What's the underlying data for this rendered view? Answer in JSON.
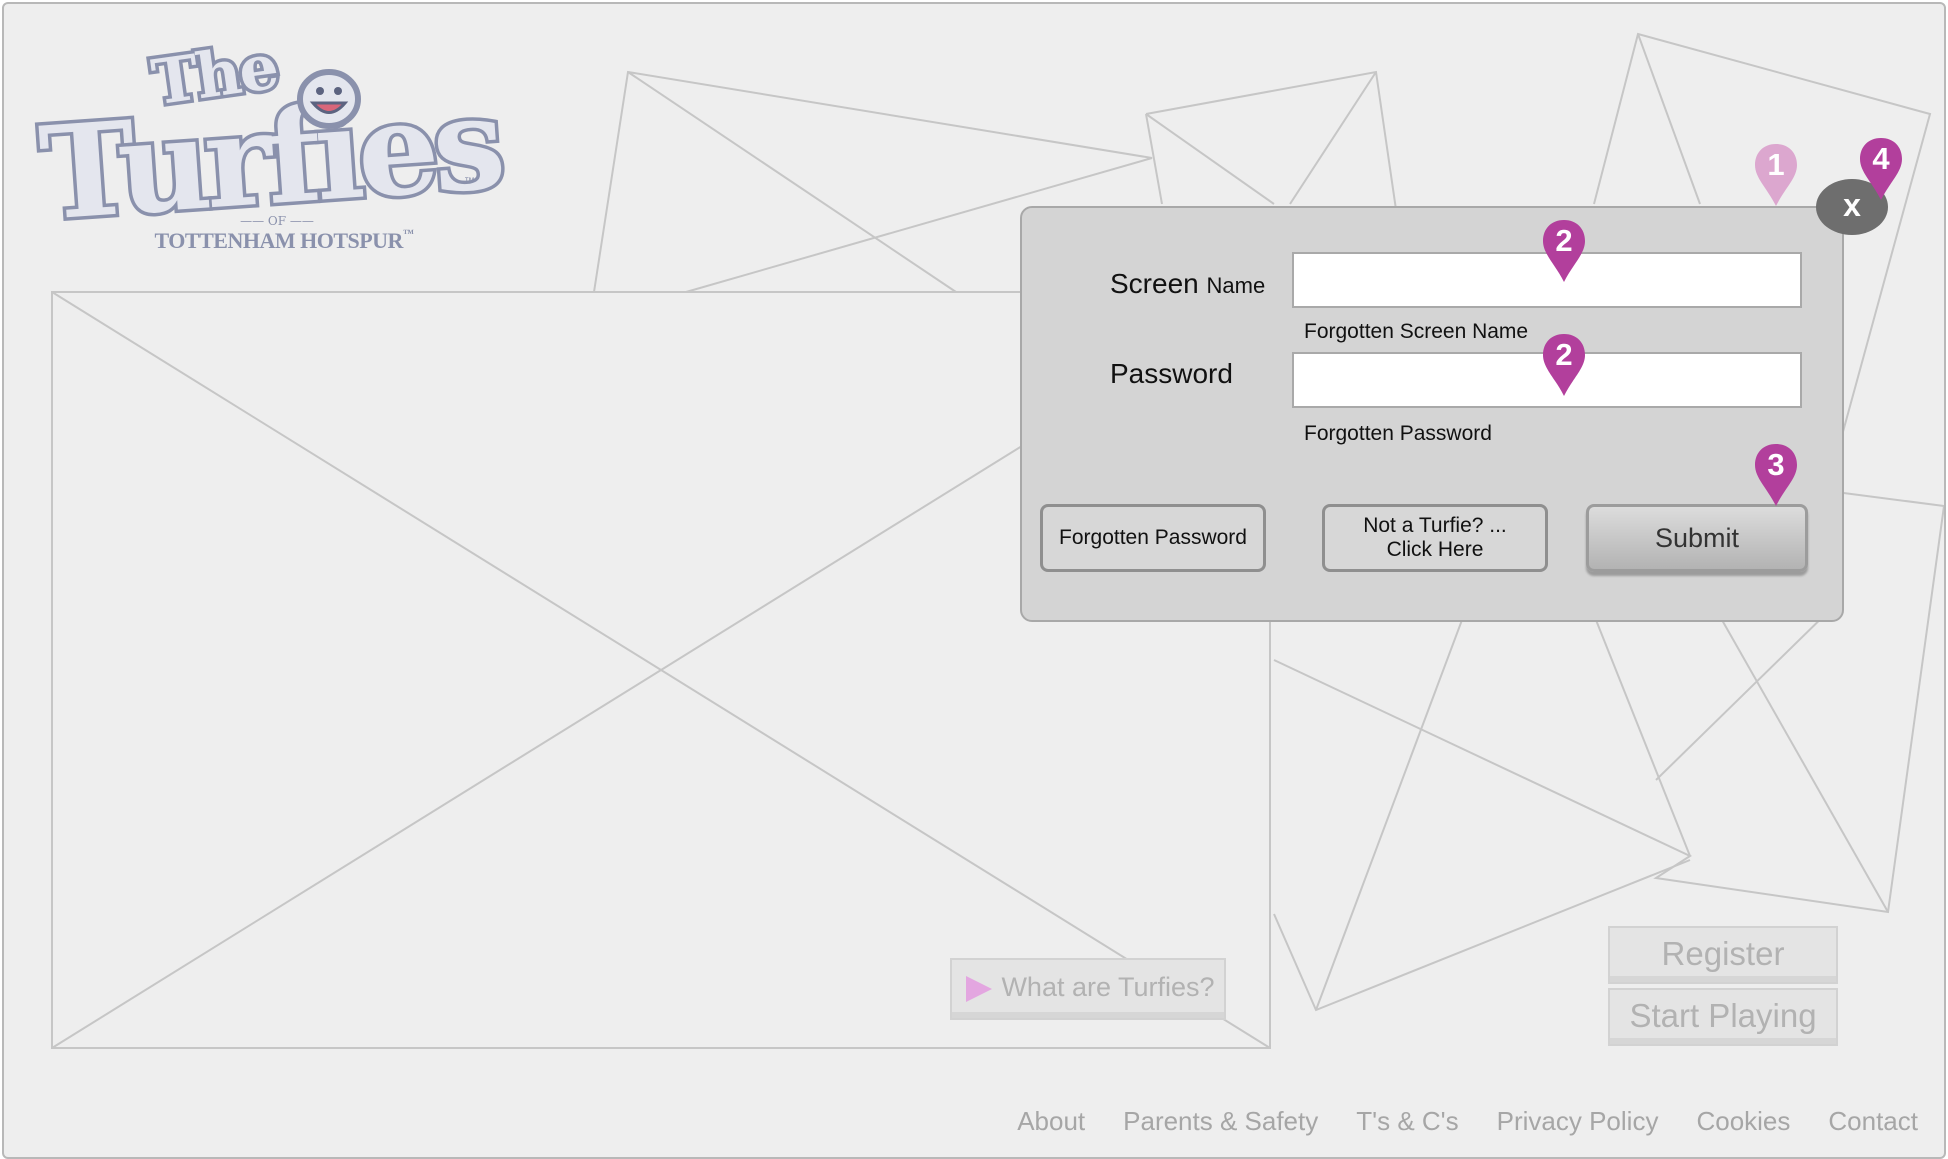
{
  "logo": {
    "title_small": "The",
    "title_large": "Turfies",
    "of": "OF",
    "subtitle": "TOTTENHAM HOTSPUR",
    "trademark": "™"
  },
  "placeholders": {
    "what_button": "What are Turfies?",
    "register_button": "Register",
    "start_button": "Start Playing"
  },
  "footer": {
    "links": [
      "About",
      "Parents & Safety",
      "T's & C's",
      "Privacy Policy",
      "Cookies",
      "Contact"
    ]
  },
  "login_dialog": {
    "screen_name_label": "Screen",
    "screen_name_label_suffix": "Name",
    "screen_name_value": "",
    "password_label": "Password",
    "password_value": "",
    "forgotten_screen_name": "Forgotten Screen Name",
    "forgotten_password_link": "Forgotten Password",
    "forgotten_password_button": "Forgotten Password",
    "not_turfie_line1": "Not a Turfie? ...",
    "not_turfie_line2": "Click Here",
    "submit_button": "Submit",
    "close_button": "x"
  },
  "annotations": [
    {
      "label": "1",
      "color": "#dca7cf"
    },
    {
      "label": "2",
      "color": "#b23f9c"
    },
    {
      "label": "2",
      "color": "#b23f9c"
    },
    {
      "label": "3",
      "color": "#b23f9c"
    },
    {
      "label": "4",
      "color": "#b23f9c"
    }
  ],
  "colors": {
    "annotation_pin": "#b23f9c",
    "annotation_pin_light": "#dca7cf",
    "logo_outline": "#8a91ac",
    "play_arrow": "#e3a6e0"
  }
}
